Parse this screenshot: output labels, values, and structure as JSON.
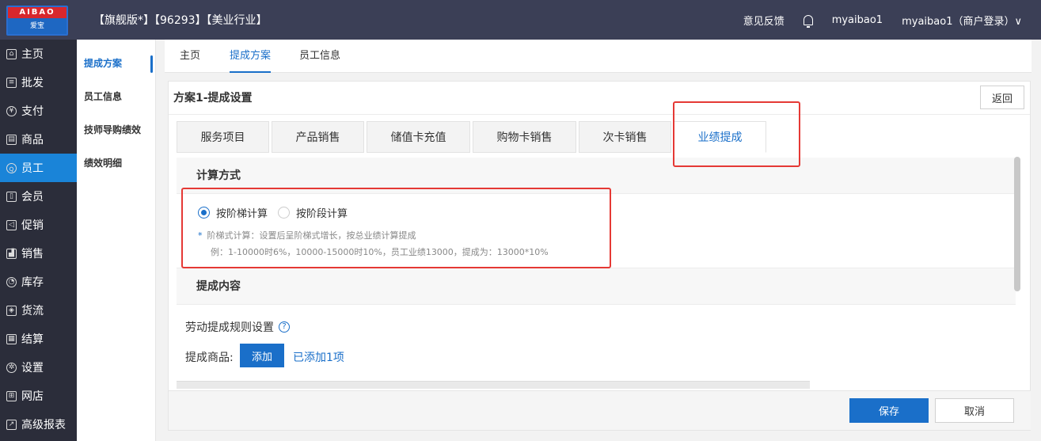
{
  "logo": {
    "top_text": "AIBAO",
    "bottom_text": "爱宝"
  },
  "header": {
    "shop_title": "【旗舰版*】【96293】【美业行业】",
    "feedback": "意见反馈",
    "username": "myaibao1",
    "account": "myaibao1（商户登录）∨"
  },
  "nav": [
    {
      "label": "主页",
      "icon": "home-icon"
    },
    {
      "label": "批发",
      "icon": "list-icon"
    },
    {
      "label": "支付",
      "icon": "yen-icon"
    },
    {
      "label": "商品",
      "icon": "box-icon"
    },
    {
      "label": "员工",
      "icon": "people-icon"
    },
    {
      "label": "会员",
      "icon": "member-icon"
    },
    {
      "label": "促销",
      "icon": "megaphone-icon"
    },
    {
      "label": "销售",
      "icon": "chart-icon"
    },
    {
      "label": "库存",
      "icon": "pie-icon"
    },
    {
      "label": "货流",
      "icon": "cube-icon"
    },
    {
      "label": "结算",
      "icon": "document-icon"
    },
    {
      "label": "设置",
      "icon": "gear-icon"
    },
    {
      "label": "网店",
      "icon": "gift-icon"
    },
    {
      "label": "高级报表",
      "icon": "trend-icon"
    }
  ],
  "sub_nav": [
    "提成方案",
    "员工信息",
    "技师导购绩效",
    "绩效明细"
  ],
  "tabs": [
    "主页",
    "提成方案",
    "员工信息"
  ],
  "panel": {
    "title": "方案1-提成设置",
    "back": "返回",
    "categories": [
      "服务项目",
      "产品销售",
      "储值卡充值",
      "购物卡销售",
      "次卡销售",
      "业绩提成"
    ]
  },
  "calc": {
    "heading": "计算方式",
    "option1": "按阶梯计算",
    "option2": "按阶段计算",
    "tip_star": "*",
    "tip1": "阶梯式计算：设置后呈阶梯式增长，按总业绩计算提成",
    "tip2": "例：1-10000时6%，10000-15000时10%，员工业绩13000，提成为：13000*10%"
  },
  "commission": {
    "heading": "提成内容",
    "rule_label": "劳动提成规则设置",
    "help": "?",
    "product_label": "提成商品:",
    "add_button": "添加",
    "added_text": "已添加1项"
  },
  "footer": {
    "save": "保存",
    "cancel": "取消"
  },
  "colors": {
    "accent": "#1a6fc9",
    "topbar": "#3b3f56",
    "sidebar": "#2b2d3a",
    "highlight_box": "#e53935"
  }
}
